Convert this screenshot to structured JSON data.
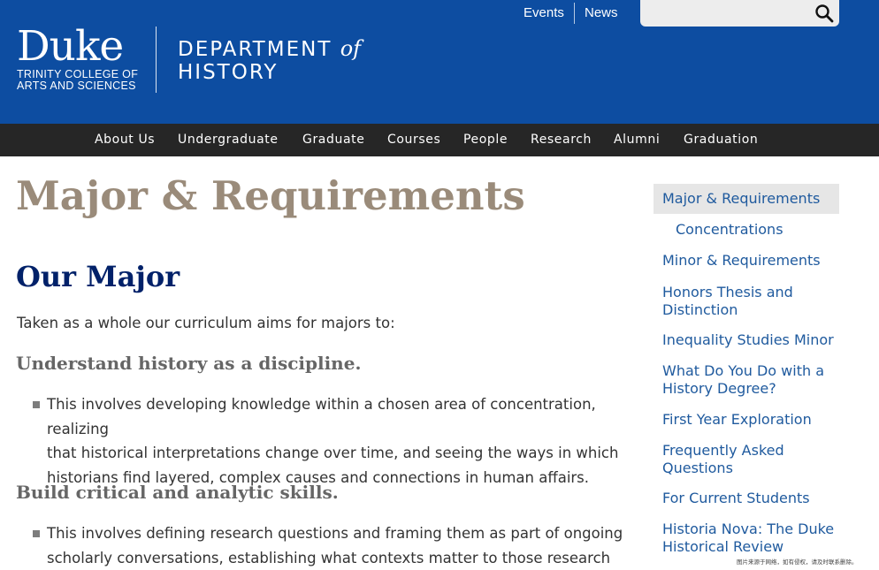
{
  "header": {
    "logo_main": "Duke",
    "logo_sub_line1": "TRINITY COLLEGE OF",
    "logo_sub_line2": "ARTS AND SCIENCES",
    "dept_word1": "DEPARTMENT",
    "dept_of": "of",
    "dept_word2": "HISTORY",
    "util_links": [
      "Events",
      "News"
    ],
    "search_placeholder": "",
    "colors": {
      "brand_blue": "#0d4da1",
      "nav_bg": "#262626"
    }
  },
  "nav": {
    "items": [
      "About Us",
      "Undergraduate",
      "Graduate",
      "Courses",
      "People",
      "Research",
      "Alumni",
      "Graduation"
    ]
  },
  "main": {
    "page_title": "Major & Requirements",
    "section_title": "Our Major",
    "intro": "Taken as a whole our curriculum aims for majors to:",
    "goals": [
      {
        "heading": "Understand history as a discipline.",
        "lines": [
          "This involves developing knowledge within a chosen area of concentration, realizing",
          "that historical interpretations change over time, and seeing the ways in which",
          "historians find layered, complex causes and connections in human affairs."
        ]
      },
      {
        "heading": "Build critical and analytic skills.",
        "lines": [
          "This involves defining research questions and framing them as part of ongoing",
          "scholarly conversations, establishing what contexts matter to those research"
        ]
      }
    ]
  },
  "sidebar": {
    "items": [
      {
        "label": "Major & Requirements",
        "active": true
      },
      {
        "label": "Concentrations"
      },
      {
        "label": "Minor & Requirements"
      },
      {
        "label": "Honors Thesis and Distinction"
      },
      {
        "label": "Inequality Studies Minor"
      },
      {
        "label": "What Do You Do with a History Degree?"
      },
      {
        "label": "First Year Exploration"
      },
      {
        "label": "Frequently Asked Questions"
      },
      {
        "label": "For Current Students"
      },
      {
        "label": "Historia Nova: The Duke Historical Review"
      }
    ]
  },
  "watermark": "图片来源于网络，如有侵权，请及时联系删除。"
}
